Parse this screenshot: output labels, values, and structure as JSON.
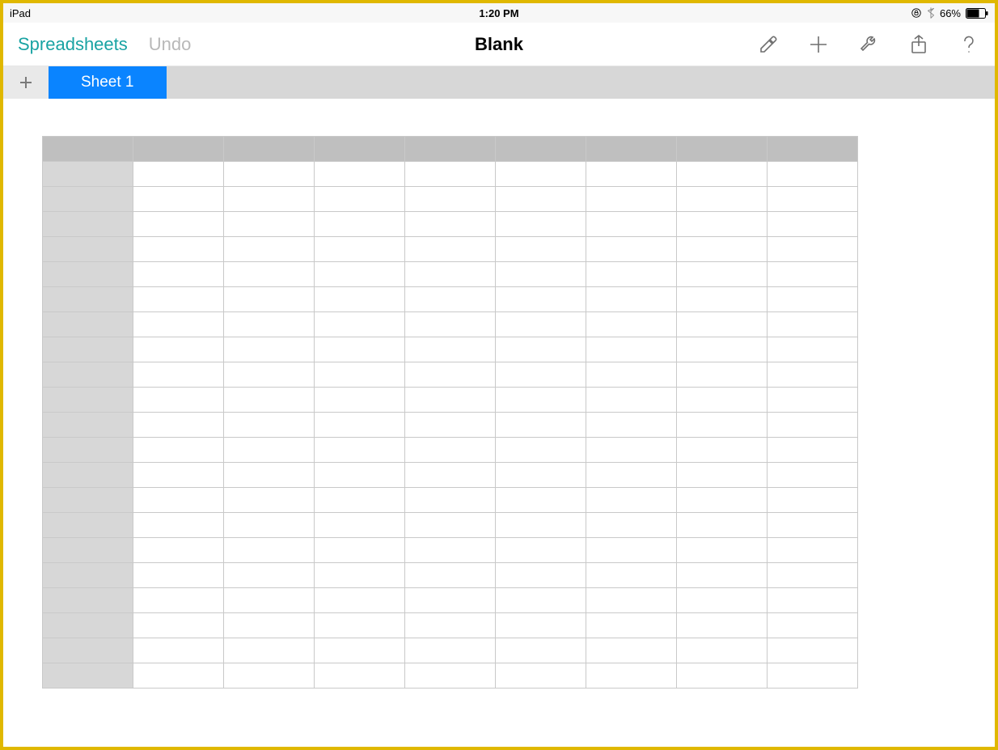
{
  "status": {
    "device": "iPad",
    "time": "1:20 PM",
    "battery_percent": "66%"
  },
  "toolbar": {
    "back_label": "Spreadsheets",
    "undo_label": "Undo",
    "title": "Blank"
  },
  "tabs": {
    "active": "Sheet 1"
  },
  "grid": {
    "columns": 8,
    "rows": 21
  }
}
